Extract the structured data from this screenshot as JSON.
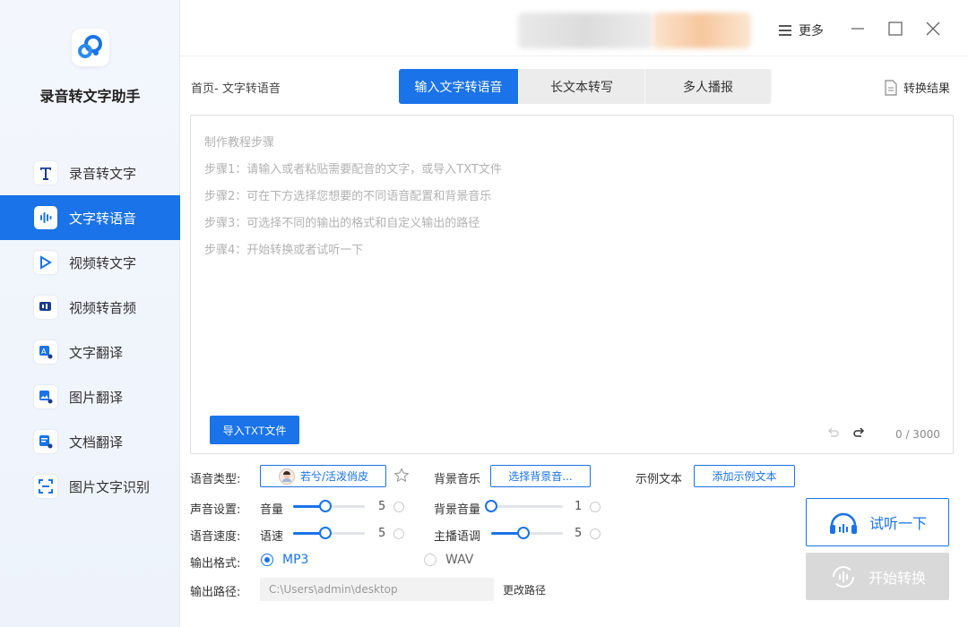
{
  "app": {
    "title": "录音转文字助手"
  },
  "sidebar": {
    "items": [
      {
        "label": "录音转文字",
        "icon": "text-t-icon"
      },
      {
        "label": "文字转语音",
        "icon": "sound-wave-icon",
        "active": true
      },
      {
        "label": "视频转文字",
        "icon": "video-play-icon"
      },
      {
        "label": "视频转音频",
        "icon": "video-audio-icon"
      },
      {
        "label": "文字翻译",
        "icon": "text-translate-icon"
      },
      {
        "label": "图片翻译",
        "icon": "image-translate-icon"
      },
      {
        "label": "文档翻译",
        "icon": "document-translate-icon"
      },
      {
        "label": "图片文字识别",
        "icon": "scan-icon"
      }
    ]
  },
  "topbar": {
    "more_label": "更多"
  },
  "breadcrumb": "首页- 文字转语音",
  "tabs": [
    {
      "label": "输入文字转语音",
      "active": true
    },
    {
      "label": "长文本转写"
    },
    {
      "label": "多人播报"
    }
  ],
  "result_link": "转换结果",
  "editor": {
    "placeholder": "制作教程步骤\n步骤1：请输入或者粘贴需要配音的文字，或导入TXT文件\n步骤2：可在下方选择您想要的不同语音配置和背景音乐\n步骤3：可选择不同的输出的格式和自定义输出的路径\n步骤4：开始转换或者试听一下",
    "import_label": "导入TXT文件",
    "counter": "0 / 3000"
  },
  "settings": {
    "voice_type_label": "语音类型:",
    "voice_name": "若兮/活泼俏皮",
    "bg_music_label": "背景音乐",
    "bg_music_button": "选择背景音...",
    "sample_text_label": "示例文本",
    "sample_text_button": "添加示例文本",
    "sound_settings_label": "声音设置:",
    "volume_label": "音量",
    "volume_value": "5",
    "bg_volume_label": "背景音量",
    "bg_volume_value": "1",
    "speed_section_label": "语音速度:",
    "speed_label": "语速",
    "speed_value": "5",
    "pitch_label": "主播语调",
    "pitch_value": "5",
    "output_format_label": "输出格式:",
    "format_mp3": "MP3",
    "format_wav": "WAV",
    "output_path_label": "输出路径:",
    "output_path_value": "C:\\Users\\admin\\desktop",
    "change_path_label": "更改路径"
  },
  "actions": {
    "listen_label": "试听一下",
    "start_label": "开始转换"
  },
  "colors": {
    "accent": "#1a73e8",
    "disabled": "#d9d9d9"
  }
}
